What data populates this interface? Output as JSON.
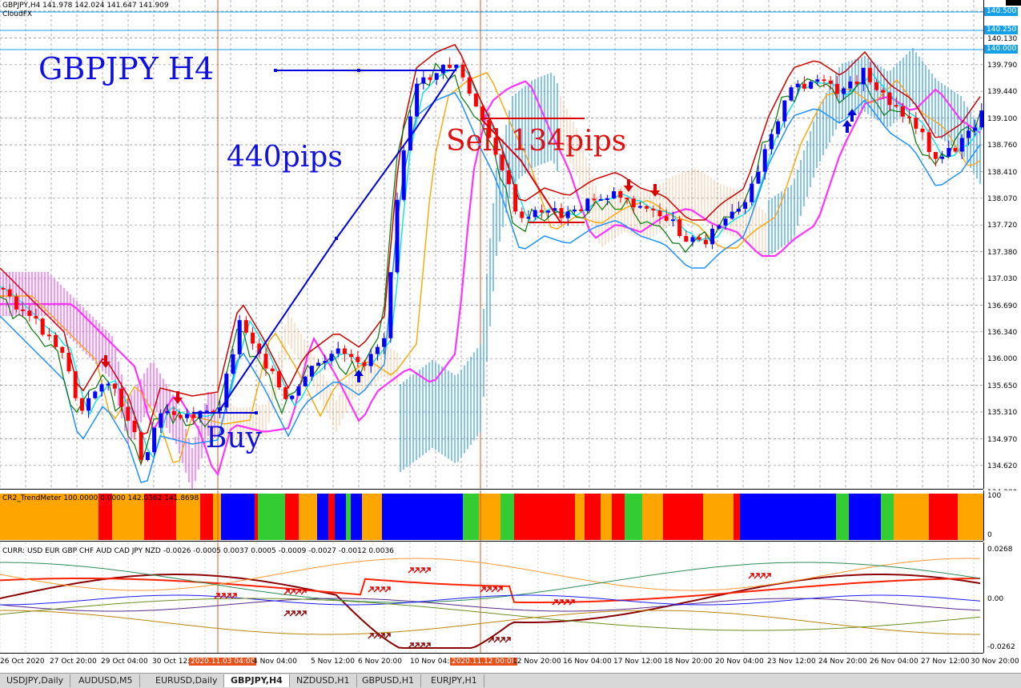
{
  "header": {
    "symbol_line": "GBPJPY,H4  141.978 142.024 141.647 141.909",
    "indicator": "CloudFX"
  },
  "annotations": {
    "title": "GBPJPY H4",
    "buy_pips": "440pips",
    "buy": "Buy",
    "sell_pips": "Sell 134pips"
  },
  "price_axis": {
    "labels": [
      "139.790",
      "139.440",
      "139.100",
      "138.760",
      "138.410",
      "138.070",
      "137.720",
      "137.380",
      "137.030",
      "136.690",
      "136.340",
      "136.000",
      "135.650",
      "135.310",
      "134.970",
      "134.620",
      "134.280"
    ],
    "extra_labels": [
      "140.130"
    ],
    "boxes": [
      "140.500",
      "140.250",
      "140.000"
    ]
  },
  "trendmeter": {
    "label": "CR2_TrendMeter 100.0000 0.0000 142.0362 141.8698",
    "axis_top": "100",
    "axis_bottom": "0",
    "colors": {
      "red": "#ff0000",
      "orange": "#ffa500",
      "blue": "#0000ff",
      "green": "#33cc33"
    }
  },
  "currency_meter": {
    "label": "CURR: USD EUR GBP CHF AUD CAD JPY NZD -0.0026 -0.0005 0.0037 0.0005 -0.0009 -0.0027 -0.0012 0.0036",
    "axis_labels": [
      "0.0268",
      "0.00",
      "-0.0262"
    ]
  },
  "time_axis": [
    {
      "label": "26 Oct 2020",
      "hl": false
    },
    {
      "label": "27 Oct 20:00",
      "hl": false
    },
    {
      "label": "29 Oct 04:00",
      "hl": false
    },
    {
      "label": "30 Oct 12:00",
      "hl": false
    },
    {
      "label": "2020.11.03 04:00",
      "hl": true
    },
    {
      "label": "4 Nov 04:00",
      "hl": false
    },
    {
      "label": "5 Nov 12:00",
      "hl": false
    },
    {
      "label": "6 Nov 20:00",
      "hl": false
    },
    {
      "label": "10 Nov 04:00",
      "hl": false
    },
    {
      "label": "2020.11.12 00:00",
      "hl": true
    },
    {
      "label": "12 Nov 20:00",
      "hl": false
    },
    {
      "label": "16 Nov 04:00",
      "hl": false
    },
    {
      "label": "17 Nov 12:00",
      "hl": false
    },
    {
      "label": "18 Nov 20:00",
      "hl": false
    },
    {
      "label": "20 Nov 04:00",
      "hl": false
    },
    {
      "label": "23 Nov 12:00",
      "hl": false
    },
    {
      "label": "24 Nov 20:00",
      "hl": false
    },
    {
      "label": "26 Nov 04:00",
      "hl": false
    },
    {
      "label": "27 Nov 12:00",
      "hl": false
    },
    {
      "label": "30 Nov 20:00",
      "hl": false
    }
  ],
  "tabs": [
    "USDJPY,Daily",
    "AUDUSD,M5",
    "EURUSD,Daily",
    "GBPJPY,H4",
    "NZDUSD,H1",
    "GBPUSD,H1",
    "EURJPY,H1"
  ],
  "active_tab": "GBPJPY,H4"
}
